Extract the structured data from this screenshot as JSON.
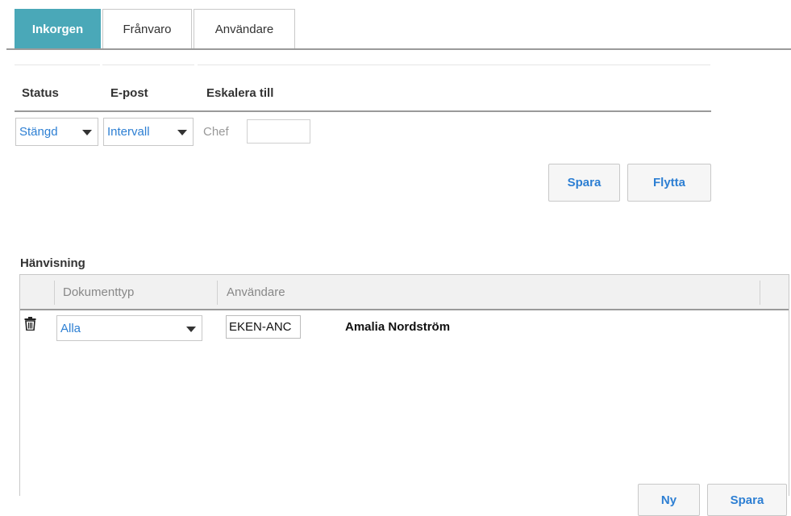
{
  "tabs": [
    {
      "label": "Inkorgen",
      "active": true
    },
    {
      "label": "Frånvaro",
      "active": false
    },
    {
      "label": "Användare",
      "active": false
    }
  ],
  "settings": {
    "headers": {
      "status": "Status",
      "email": "E-post",
      "escalate": "Eskalera till"
    },
    "status_value": "Stängd",
    "email_value": "Intervall",
    "escalate_label": "Chef",
    "escalate_value": "",
    "save_label": "Spara",
    "move_label": "Flytta"
  },
  "referral": {
    "title": "Hänvisning",
    "columns": {
      "doctype": "Dokumenttyp",
      "user": "Användare"
    },
    "rows": [
      {
        "doctype": "Alla",
        "user_code": "EKEN-ANC",
        "user_name": "Amalia Nordström"
      }
    ],
    "new_label": "Ny",
    "save_label": "Spara"
  },
  "colors": {
    "accent": "#4aa8b8",
    "link": "#2d7fd3"
  },
  "icons": {
    "delete": "trash-icon",
    "dropdown": "caret-down-icon"
  }
}
